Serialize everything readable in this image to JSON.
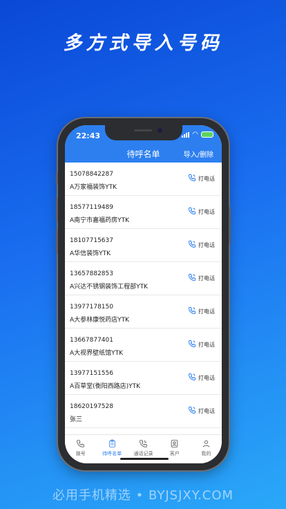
{
  "headline": "多方式导入号码",
  "brand_footer": "必用手机精选 • BYJSJXY.COM",
  "status": {
    "time": "22:43"
  },
  "nav": {
    "title": "待呼名单",
    "action": "导入/删除"
  },
  "call_label": "打电话",
  "contacts": [
    {
      "number": "15078842287",
      "name": "A万家福装饰YTK"
    },
    {
      "number": "18577119489",
      "name": "A南宁市嘉福药房YTK"
    },
    {
      "number": "18107715637",
      "name": "A华信装饰YTK"
    },
    {
      "number": "13657882853",
      "name": "A兴达不锈钢装饰工程部YTK"
    },
    {
      "number": "13977178150",
      "name": "A大参林康悦药店YTK"
    },
    {
      "number": "13667877401",
      "name": "A大视界壁纸馆YTK"
    },
    {
      "number": "13977151556",
      "name": "A百草堂(衡阳西路店)YTK"
    },
    {
      "number": "18620197528",
      "name": "张三"
    }
  ],
  "tabs": [
    {
      "label": "拨号",
      "icon": "phone-icon"
    },
    {
      "label": "待呼名单",
      "icon": "clipboard-icon",
      "active": true
    },
    {
      "label": "通话记录",
      "icon": "call-log-icon"
    },
    {
      "label": "客户",
      "icon": "contact-card-icon"
    },
    {
      "label": "我的",
      "icon": "user-icon"
    }
  ],
  "colors": {
    "accent": "#2d7ff0",
    "bg_top": "#0a48d6",
    "bg_bottom": "#2aa8f8"
  }
}
